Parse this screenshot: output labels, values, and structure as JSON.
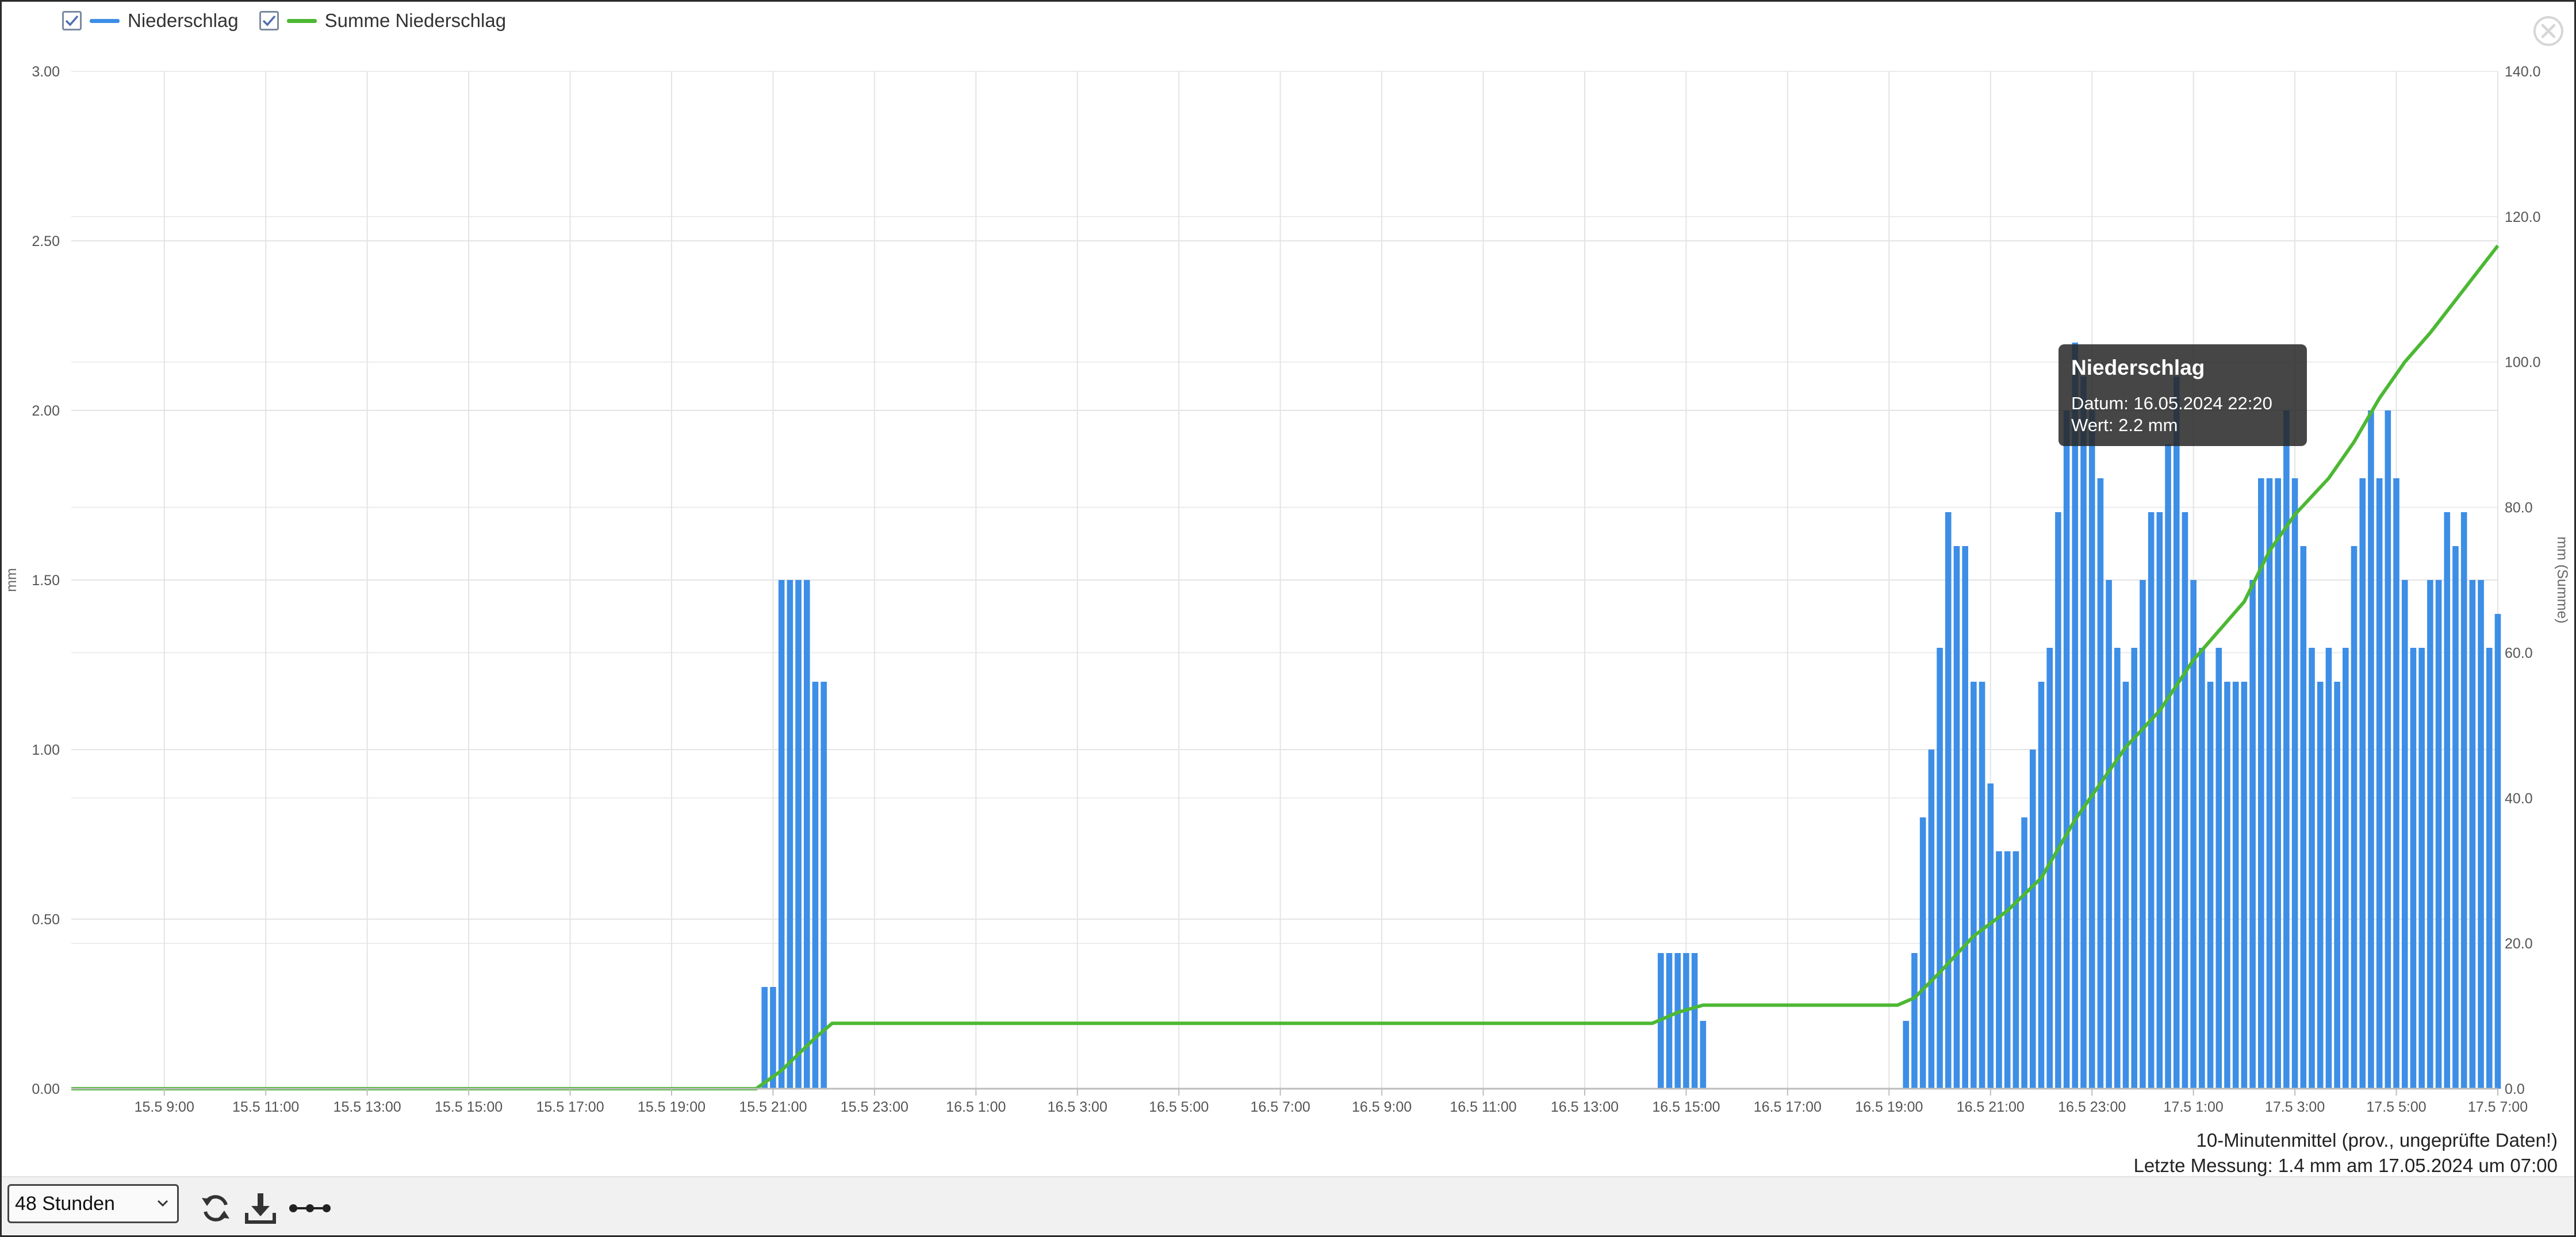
{
  "legend": {
    "items": [
      {
        "label": "Niederschlag",
        "color": "#3d8ee6",
        "checked": true
      },
      {
        "label": "Summe Niederschlag",
        "color": "#4cb833",
        "checked": true
      }
    ]
  },
  "tooltip": {
    "title": "Niederschlag",
    "date_line": "Datum: 16.05.2024 22:20",
    "value_line": "Wert: 2.2 mm"
  },
  "info": {
    "line1": "10-Minutenmittel (prov., ungeprüfte Daten!)",
    "line2": "Letzte Messung: 1.4 mm am 17.05.2024 um 07:00"
  },
  "toolbar": {
    "range_value": "48 Stunden",
    "icons": [
      "refresh-icon",
      "download-icon",
      "line-style-icon"
    ]
  },
  "colors": {
    "bar": "#3d8ee6",
    "sum_line": "#4cb833",
    "grid": "#e4e4e4"
  },
  "chart_data": {
    "type": "bar",
    "title": "",
    "interval_minutes": 10,
    "x_range": [
      "15.05.2024 07:10",
      "17.05.2024 07:00"
    ],
    "x_tick_labels": [
      "15.5 9:00",
      "15.5 11:00",
      "15.5 13:00",
      "15.5 15:00",
      "15.5 17:00",
      "15.5 19:00",
      "15.5 21:00",
      "15.5 23:00",
      "16.5 1:00",
      "16.5 3:00",
      "16.5 5:00",
      "16.5 7:00",
      "16.5 9:00",
      "16.5 11:00",
      "16.5 13:00",
      "16.5 15:00",
      "16.5 17:00",
      "16.5 19:00",
      "16.5 21:00",
      "16.5 23:00",
      "17.5 1:00",
      "17.5 3:00",
      "17.5 5:00",
      "17.5 7:00"
    ],
    "y_left": {
      "label": "mm",
      "ylim": [
        0,
        3.0
      ],
      "ticks": [
        "0.00",
        "0.50",
        "1.00",
        "1.50",
        "2.00",
        "2.50",
        "3.00"
      ]
    },
    "y_right": {
      "label": "mm (Summe)",
      "ylim": [
        0,
        140
      ],
      "ticks": [
        "0.0",
        "20.0",
        "40.0",
        "60.0",
        "80.0",
        "100.0",
        "120.0",
        "140.0"
      ]
    },
    "series": [
      {
        "name": "Niederschlag",
        "axis": "left",
        "kind": "bar",
        "points": [
          [
            "15.05 20:50",
            0.3
          ],
          [
            "15.05 21:00",
            0.3
          ],
          [
            "15.05 21:10",
            1.5
          ],
          [
            "15.05 21:20",
            1.5
          ],
          [
            "15.05 21:30",
            1.5
          ],
          [
            "15.05 21:40",
            1.5
          ],
          [
            "15.05 21:50",
            1.2
          ],
          [
            "15.05 22:00",
            1.2
          ],
          [
            "16.05 14:30",
            0.4
          ],
          [
            "16.05 14:40",
            0.4
          ],
          [
            "16.05 14:50",
            0.4
          ],
          [
            "16.05 15:00",
            0.4
          ],
          [
            "16.05 15:10",
            0.4
          ],
          [
            "16.05 15:20",
            0.2
          ],
          [
            "16.05 19:20",
            0.2
          ],
          [
            "16.05 19:30",
            0.4
          ],
          [
            "16.05 19:40",
            0.8
          ],
          [
            "16.05 19:50",
            1.0
          ],
          [
            "16.05 20:00",
            1.3
          ],
          [
            "16.05 20:10",
            1.7
          ],
          [
            "16.05 20:20",
            1.6
          ],
          [
            "16.05 20:30",
            1.6
          ],
          [
            "16.05 20:40",
            1.2
          ],
          [
            "16.05 20:50",
            1.2
          ],
          [
            "16.05 21:00",
            0.9
          ],
          [
            "16.05 21:10",
            0.7
          ],
          [
            "16.05 21:20",
            0.7
          ],
          [
            "16.05 21:30",
            0.7
          ],
          [
            "16.05 21:40",
            0.8
          ],
          [
            "16.05 21:50",
            1.0
          ],
          [
            "16.05 22:00",
            1.2
          ],
          [
            "16.05 22:10",
            1.3
          ],
          [
            "16.05 22:20",
            1.7
          ],
          [
            "16.05 22:30",
            2.0
          ],
          [
            "16.05 22:40",
            2.2
          ],
          [
            "16.05 22:50",
            2.1
          ],
          [
            "16.05 23:00",
            2.0
          ],
          [
            "16.05 23:10",
            1.8
          ],
          [
            "16.05 23:20",
            1.5
          ],
          [
            "16.05 23:30",
            1.3
          ],
          [
            "16.05 23:40",
            1.2
          ],
          [
            "16.05 23:50",
            1.3
          ],
          [
            "17.05 00:00",
            1.5
          ],
          [
            "17.05 00:10",
            1.7
          ],
          [
            "17.05 00:20",
            1.7
          ],
          [
            "17.05 00:30",
            1.9
          ],
          [
            "17.05 00:40",
            2.1
          ],
          [
            "17.05 00:50",
            1.7
          ],
          [
            "17.05 01:00",
            1.5
          ],
          [
            "17.05 01:10",
            1.3
          ],
          [
            "17.05 01:20",
            1.2
          ],
          [
            "17.05 01:30",
            1.3
          ],
          [
            "17.05 01:40",
            1.2
          ],
          [
            "17.05 01:50",
            1.2
          ],
          [
            "17.05 02:00",
            1.2
          ],
          [
            "17.05 02:10",
            1.5
          ],
          [
            "17.05 02:20",
            1.8
          ],
          [
            "17.05 02:30",
            1.8
          ],
          [
            "17.05 02:40",
            1.8
          ],
          [
            "17.05 02:50",
            2.0
          ],
          [
            "17.05 03:00",
            1.8
          ],
          [
            "17.05 03:10",
            1.6
          ],
          [
            "17.05 03:20",
            1.3
          ],
          [
            "17.05 03:30",
            1.2
          ],
          [
            "17.05 03:40",
            1.3
          ],
          [
            "17.05 03:50",
            1.2
          ],
          [
            "17.05 04:00",
            1.3
          ],
          [
            "17.05 04:10",
            1.6
          ],
          [
            "17.05 04:20",
            1.8
          ],
          [
            "17.05 04:30",
            2.0
          ],
          [
            "17.05 04:40",
            1.8
          ],
          [
            "17.05 04:50",
            2.0
          ],
          [
            "17.05 05:00",
            1.8
          ],
          [
            "17.05 05:10",
            1.5
          ],
          [
            "17.05 05:20",
            1.3
          ],
          [
            "17.05 05:30",
            1.3
          ],
          [
            "17.05 05:40",
            1.5
          ],
          [
            "17.05 05:50",
            1.5
          ],
          [
            "17.05 06:00",
            1.7
          ],
          [
            "17.05 06:10",
            1.6
          ],
          [
            "17.05 06:20",
            1.7
          ],
          [
            "17.05 06:30",
            1.5
          ],
          [
            "17.05 06:40",
            1.5
          ],
          [
            "17.05 06:50",
            1.3
          ],
          [
            "17.05 07:00",
            1.4
          ]
        ]
      },
      {
        "name": "Summe Niederschlag",
        "axis": "right",
        "kind": "line",
        "points": [
          [
            "15.05 07:10",
            0
          ],
          [
            "15.05 20:40",
            0
          ],
          [
            "15.05 21:10",
            2.5
          ],
          [
            "15.05 21:50",
            7.0
          ],
          [
            "15.05 22:10",
            9.0
          ],
          [
            "16.05 14:20",
            9.0
          ],
          [
            "16.05 14:50",
            10.5
          ],
          [
            "16.05 15:20",
            11.5
          ],
          [
            "16.05 19:10",
            11.5
          ],
          [
            "16.05 19:30",
            12.5
          ],
          [
            "16.05 20:00",
            16
          ],
          [
            "16.05 20:40",
            21
          ],
          [
            "16.05 21:20",
            24.5
          ],
          [
            "16.05 22:00",
            29
          ],
          [
            "16.05 22:40",
            37
          ],
          [
            "16.05 23:10",
            42
          ],
          [
            "16.05 23:40",
            47
          ],
          [
            "17.05 00:20",
            52
          ],
          [
            "17.05 01:00",
            59
          ],
          [
            "17.05 01:30",
            63
          ],
          [
            "17.05 02:00",
            67
          ],
          [
            "17.05 02:30",
            74
          ],
          [
            "17.05 03:00",
            79
          ],
          [
            "17.05 03:40",
            84
          ],
          [
            "17.05 04:10",
            89
          ],
          [
            "17.05 04:40",
            95
          ],
          [
            "17.05 05:10",
            100
          ],
          [
            "17.05 05:40",
            104
          ],
          [
            "17.05 06:20",
            110
          ],
          [
            "17.05 07:00",
            116
          ]
        ]
      }
    ]
  }
}
